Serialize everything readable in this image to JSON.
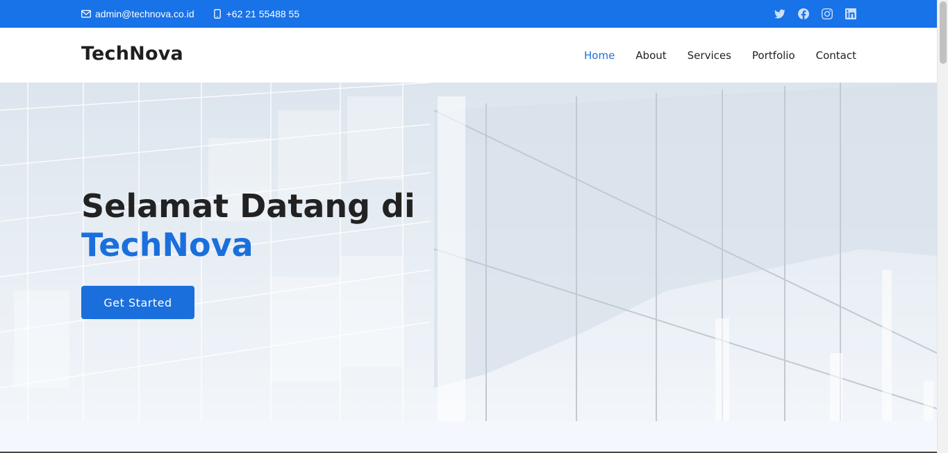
{
  "topbar": {
    "email": "admin@technova.co.id",
    "phone": "+62 21 55488 55",
    "email_icon": "envelope-icon",
    "phone_icon": "phone-icon",
    "social": [
      "twitter-icon",
      "facebook-icon",
      "instagram-icon",
      "linkedin-icon"
    ],
    "color": "#1872e8"
  },
  "header": {
    "logo": "TechNova",
    "nav": [
      {
        "label": "Home",
        "active": true
      },
      {
        "label": "About",
        "active": false
      },
      {
        "label": "Services",
        "active": false
      },
      {
        "label": "Portfolio",
        "active": false
      },
      {
        "label": "Contact",
        "active": false
      }
    ]
  },
  "hero": {
    "title_line1": "Selamat Datang di",
    "title_line2": "TechNova",
    "cta_label": "Get Started",
    "accent_color": "#1a6fdc"
  }
}
